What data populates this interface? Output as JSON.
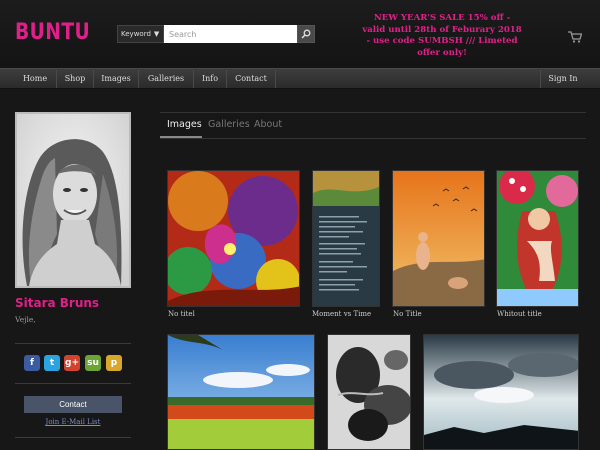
{
  "header": {
    "logo": "BUNTU",
    "search": {
      "type_label": "Keyword",
      "placeholder": "Search"
    },
    "promo": "NEW YEAR'S SALE 15% off - valid until 28th of Feburary 2018 - use code SUMBSH /// Limeted offer only!",
    "cart_icon": "cart-icon"
  },
  "nav": {
    "items": [
      "Home",
      "Shop",
      "Images",
      "Galleries",
      "Info",
      "Contact"
    ],
    "sign_in": "Sign In"
  },
  "profile": {
    "name": "Sitara Bruns",
    "location": "Vejle,"
  },
  "social": [
    {
      "icon": "facebook-icon",
      "glyph": "f",
      "color": "#3b5ca0"
    },
    {
      "icon": "twitter-icon",
      "glyph": "t",
      "color": "#2aa3e0"
    },
    {
      "icon": "googleplus-icon",
      "glyph": "g+",
      "color": "#d0442f"
    },
    {
      "icon": "stumbleupon-icon",
      "glyph": "su",
      "color": "#6ca435"
    },
    {
      "icon": "pinterest-icon",
      "glyph": "p",
      "color": "#d9a82a"
    }
  ],
  "sidebar": {
    "contact_label": "Contact",
    "mail_link": "Join E-Mail List"
  },
  "tabs": [
    "Images",
    "Galleries",
    "About"
  ],
  "gallery": {
    "items": [
      {
        "title": "No titel"
      },
      {
        "title": "Moment vs Time"
      },
      {
        "title": "No Title"
      },
      {
        "title": "Whitout title"
      },
      {
        "title": ""
      },
      {
        "title": ""
      },
      {
        "title": ""
      }
    ]
  },
  "colors": {
    "accent": "#e0208a",
    "background": "#171717",
    "nav": "#333333"
  }
}
